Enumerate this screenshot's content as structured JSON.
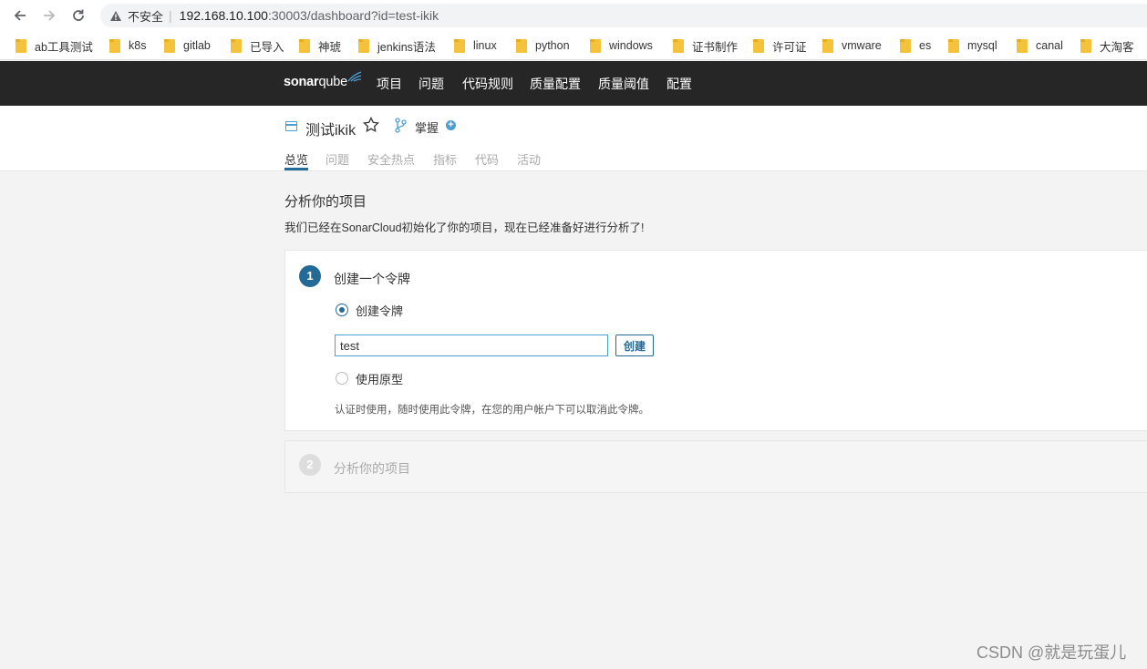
{
  "browser": {
    "security_label": "不安全",
    "url_host": "192.168.10.100",
    "url_path": ":30003/dashboard?id=test-ikik",
    "bookmarks": [
      "ab工具测试",
      "k8s",
      "gitlab",
      "已导入",
      "神琥",
      "jenkins语法",
      "linux",
      "python",
      "windows",
      "证书制作",
      "许可证",
      "vmware",
      "es",
      "mysql",
      "canal",
      "大淘客"
    ]
  },
  "sonar_nav": {
    "logo_bold": "sonar",
    "logo_light": "qube",
    "items": [
      "项目",
      "问题",
      "代码规则",
      "质量配置",
      "质量阈值",
      "配置"
    ]
  },
  "project": {
    "name": "测试ikik",
    "branch": "掌握",
    "tabs": [
      "总览",
      "问题",
      "安全热点",
      "指标",
      "代码",
      "活动"
    ]
  },
  "main": {
    "title": "分析你的项目",
    "subtitle": "我们已经在SonarCloud初始化了你的项目，现在已经准备好进行分析了!",
    "step1": {
      "number": "1",
      "title": "创建一个令牌",
      "option_create": "创建令牌",
      "token_value": "test",
      "create_button": "创建",
      "option_existing": "使用原型",
      "hint": "认证时使用，随时使用此令牌，在您的用户帐户下可以取消此令牌。"
    },
    "step2": {
      "number": "2",
      "title": "分析你的项目"
    }
  },
  "watermark": "CSDN @就是玩蛋儿",
  "colors": {
    "nav_bg": "#262626",
    "accent": "#236a97",
    "link_blue": "#4b9fd5"
  }
}
